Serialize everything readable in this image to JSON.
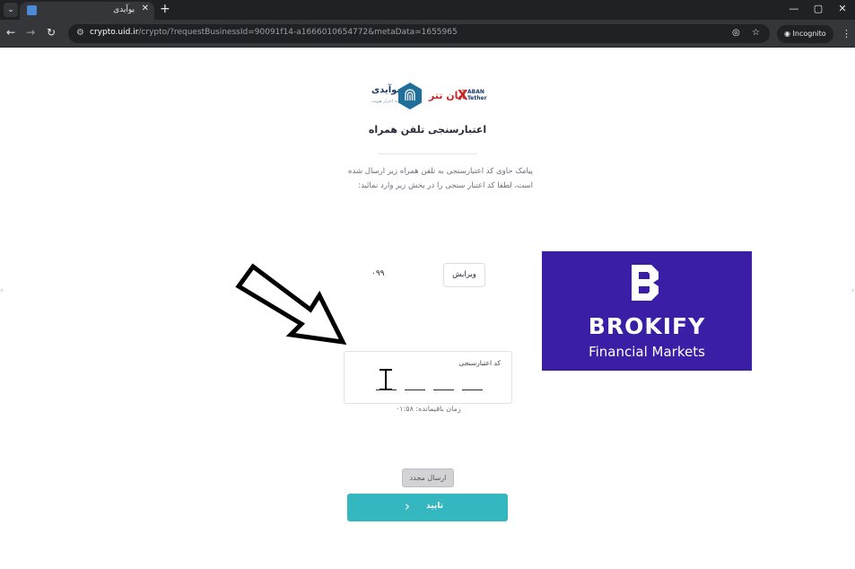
{
  "browser": {
    "tab_title": "یوآیدی",
    "tab_close": "✕",
    "new_tab": "+",
    "tab_menu": "⌄",
    "window_minimize": "—",
    "window_maximize": "▢",
    "window_close": "✕",
    "back": "←",
    "forward": "→",
    "reload": "↻",
    "url_host": "crypto.uid.ir",
    "url_path": "/crypto/?requestBusinessId=90091f14-a1666010654772&metaData=1655965",
    "incognito_label": "Incognito",
    "menu": "⋮"
  },
  "logos": {
    "uid_name": "یوآیدی",
    "uid_sub": "سامانه احراز هویت",
    "aban_fa": "آبان تتر",
    "aban_x": "X",
    "aban_en_1": "ABAN",
    "aban_en_2": "Tether"
  },
  "page": {
    "title": "اعتبارسنجی تلفن همراه",
    "instructions": "پیامک حاوی کد اعتبارسنجی به تلفن همراه زیر ارسال شده است، لطفا کد اعتبار سنجی را در بخش زیر وارد نمائید:",
    "phone_number": "۰۹۹",
    "edit_label": "ویرایش",
    "code_label": "کد اعتبارسنجی",
    "timer": "زمان باقیمانده: ۰۱:۵۸",
    "resend_label": "ارسال مجدد",
    "confirm_label": "تایید",
    "confirm_chevron": "‹"
  },
  "ad": {
    "brand": "BROKIFY",
    "tagline": "Financial Markets",
    "color": "#3b1ea6"
  },
  "colors": {
    "accent": "#35b7c0",
    "chrome_dark": "#202124",
    "chrome_bar": "#35363a"
  }
}
